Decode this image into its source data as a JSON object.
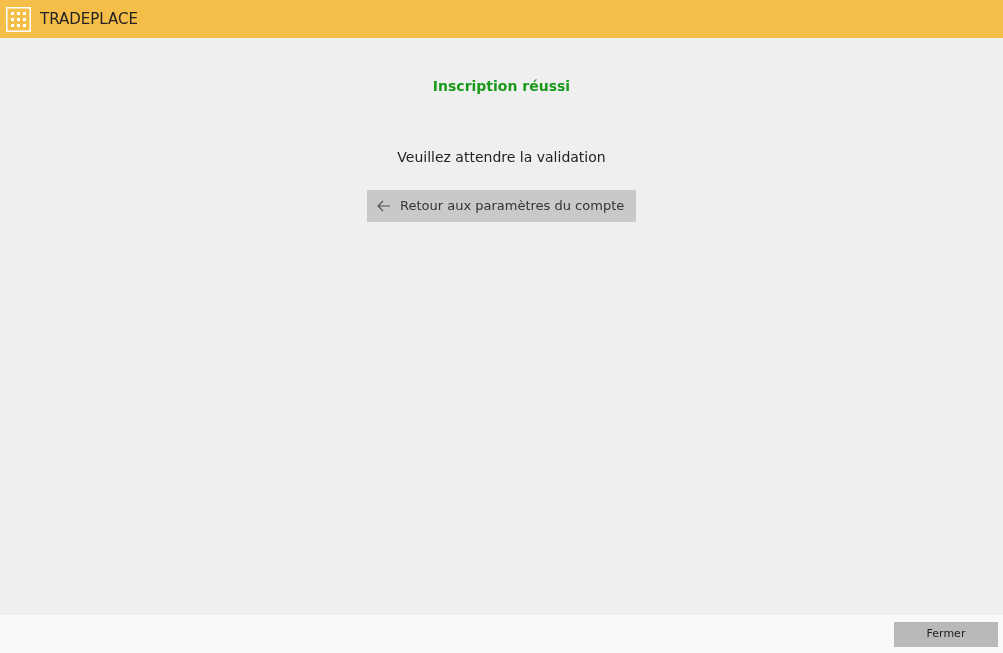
{
  "header": {
    "title": "TRADEPLACE"
  },
  "message": {
    "title": "Inscription réussi",
    "text": "Veuillez attendre la validation"
  },
  "back_button": {
    "label": "Retour aux paramètres du compte"
  },
  "footer": {
    "buttons": [
      "Fermer"
    ]
  }
}
